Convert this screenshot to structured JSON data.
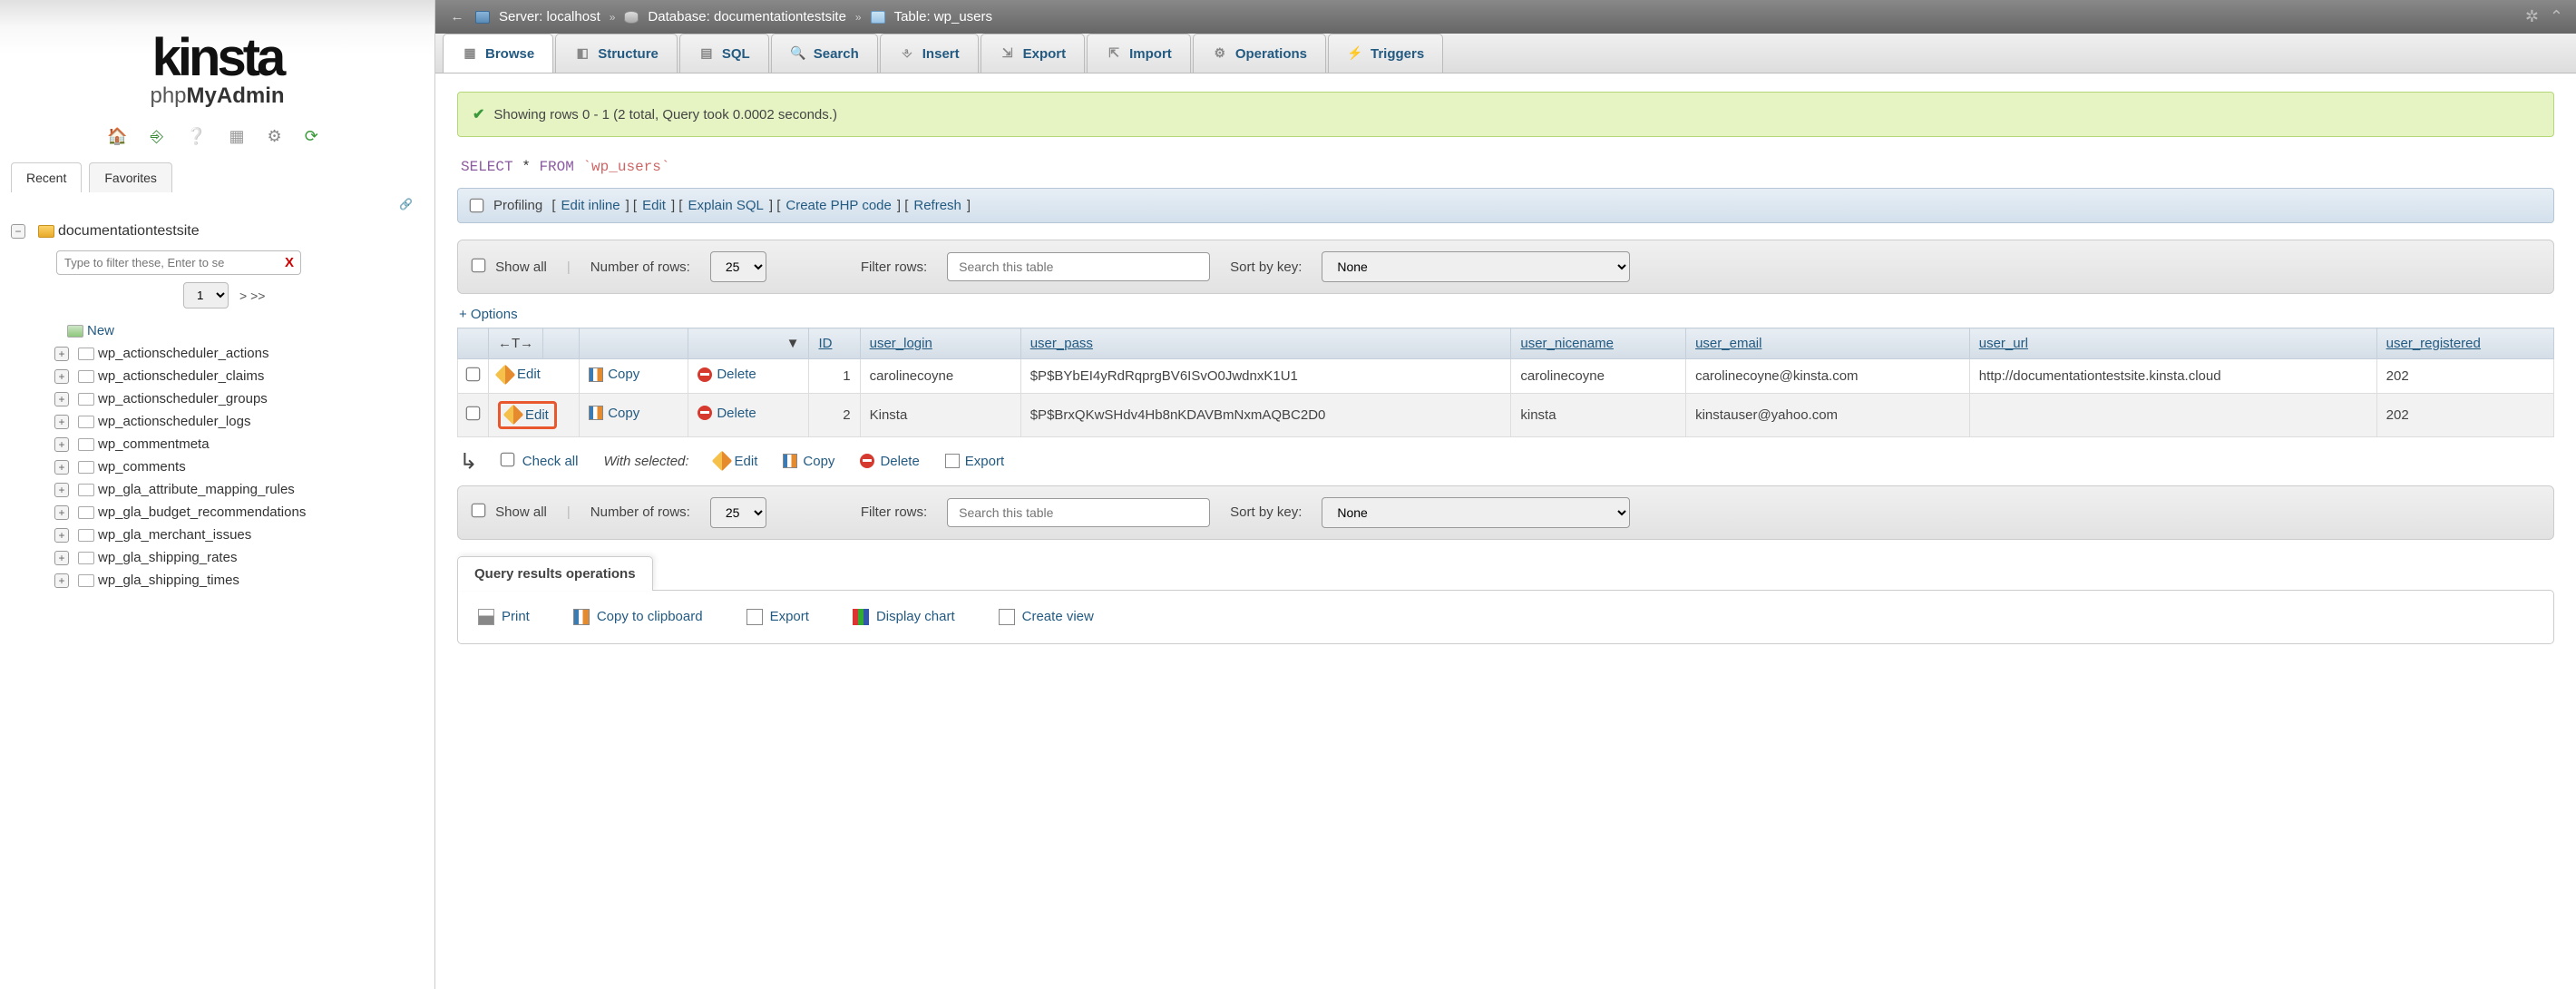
{
  "logo": {
    "line1": "kinsta",
    "line2_pre": "php",
    "line2_bold": "MyAdmin"
  },
  "sidebar": {
    "tabs": {
      "recent": "Recent",
      "favorites": "Favorites"
    },
    "db_name": "documentationtestsite",
    "filter_placeholder": "Type to filter these, Enter to se",
    "page": "1",
    "paging": "> >>",
    "new_label": "New",
    "tables": [
      "wp_actionscheduler_actions",
      "wp_actionscheduler_claims",
      "wp_actionscheduler_groups",
      "wp_actionscheduler_logs",
      "wp_commentmeta",
      "wp_comments",
      "wp_gla_attribute_mapping_rules",
      "wp_gla_budget_recommendations",
      "wp_gla_merchant_issues",
      "wp_gla_shipping_rates",
      "wp_gla_shipping_times"
    ]
  },
  "breadcrumb": {
    "server_lbl": "Server:",
    "server": "localhost",
    "db_lbl": "Database:",
    "db": "documentationtestsite",
    "table_lbl": "Table:",
    "table": "wp_users"
  },
  "maintabs": [
    "Browse",
    "Structure",
    "SQL",
    "Search",
    "Insert",
    "Export",
    "Import",
    "Operations",
    "Triggers"
  ],
  "success_msg": "Showing rows 0 - 1 (2 total, Query took 0.0002 seconds.)",
  "sql": {
    "select": "SELECT",
    "star": "*",
    "from": "FROM",
    "tbl": "`wp_users`"
  },
  "querybar": {
    "profiling": "Profiling",
    "edit_inline": "Edit inline",
    "edit": "Edit",
    "explain": "Explain SQL",
    "create_php": "Create PHP code",
    "refresh": "Refresh"
  },
  "controls": {
    "show_all": "Show all",
    "num_rows_lbl": "Number of rows:",
    "num_rows": "25",
    "filter_lbl": "Filter rows:",
    "filter_placeholder": "Search this table",
    "sort_lbl": "Sort by key:",
    "sort_val": "None"
  },
  "options_label": "+ Options",
  "columns": [
    "ID",
    "user_login",
    "user_pass",
    "user_nicename",
    "user_email",
    "user_url",
    "user_registered"
  ],
  "row_actions": {
    "edit": "Edit",
    "copy": "Copy",
    "delete": "Delete"
  },
  "rows": [
    {
      "id": "1",
      "user_login": "carolinecoyne",
      "user_pass": "$P$BYbEI4yRdRqprgBV6ISvO0JwdnxK1U1",
      "nicename": "carolinecoyne",
      "email": "carolinecoyne@kinsta.com",
      "url": "http://documentationtestsite.kinsta.cloud",
      "reg": "202"
    },
    {
      "id": "2",
      "user_login": "Kinsta",
      "user_pass": "$P$BrxQKwSHdv4Hb8nKDAVBmNxmAQBC2D0",
      "nicename": "kinsta",
      "email": "kinstauser@yahoo.com",
      "url": "",
      "reg": "202"
    }
  ],
  "bulk": {
    "check_all": "Check all",
    "with_selected": "With selected:",
    "edit": "Edit",
    "copy": "Copy",
    "delete": "Delete",
    "export": "Export"
  },
  "qro": {
    "title": "Query results operations",
    "print": "Print",
    "copy_clip": "Copy to clipboard",
    "export": "Export",
    "chart": "Display chart",
    "view": "Create view"
  }
}
